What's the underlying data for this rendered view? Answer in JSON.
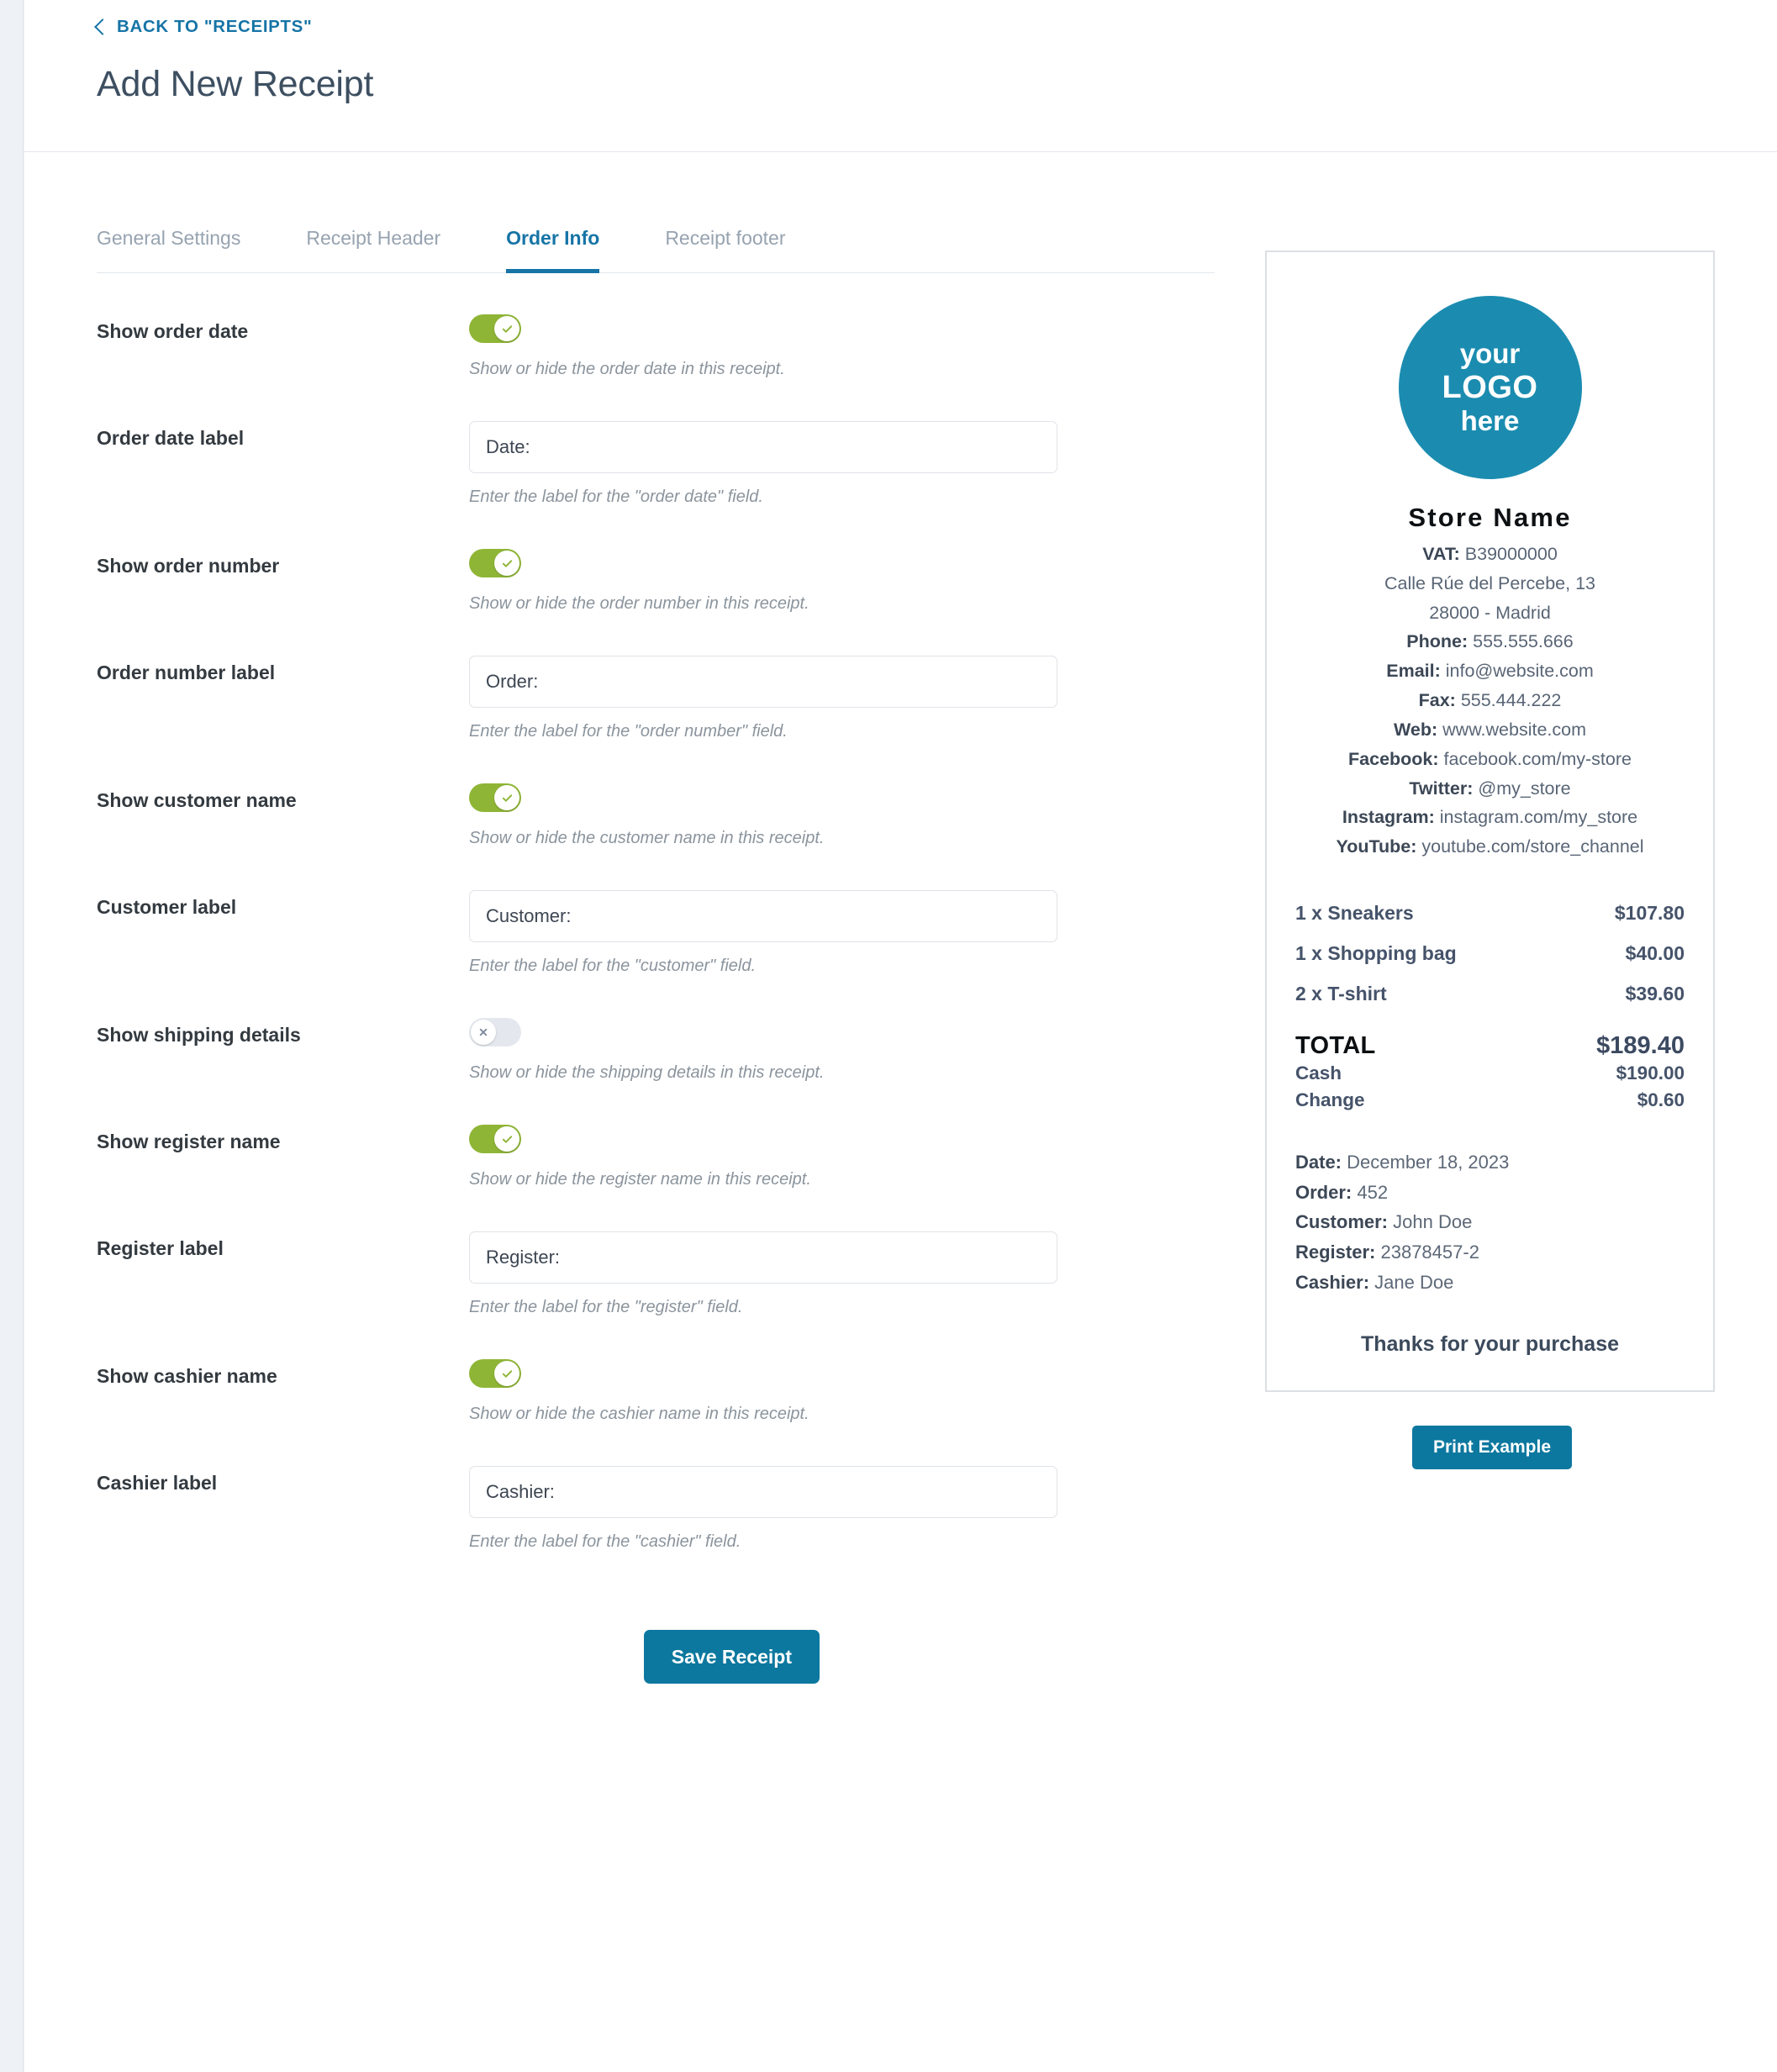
{
  "header": {
    "back_label": "BACK TO \"RECEIPTS\"",
    "title": "Add New Receipt"
  },
  "tabs": [
    {
      "label": "General Settings",
      "active": false
    },
    {
      "label": "Receipt Header",
      "active": false
    },
    {
      "label": "Order Info",
      "active": true
    },
    {
      "label": "Receipt footer",
      "active": false
    }
  ],
  "fields": {
    "show_order_date": {
      "label": "Show order date",
      "hint": "Show or hide the order date in this receipt.",
      "state": "on"
    },
    "order_date_label": {
      "label": "Order date label",
      "value": "Date:",
      "placeholder": "Date:",
      "hint": "Enter the label for the \"order date\" field."
    },
    "show_order_number": {
      "label": "Show order number",
      "hint": "Show or hide the order number in this receipt.",
      "state": "on"
    },
    "order_number_label": {
      "label": "Order number label",
      "value": "Order:",
      "placeholder": "Order:",
      "hint": "Enter the label for the \"order number\" field."
    },
    "show_customer_name": {
      "label": "Show customer name",
      "hint": "Show or hide the customer name in this receipt.",
      "state": "on"
    },
    "customer_label": {
      "label": "Customer label",
      "value": "Customer:",
      "placeholder": "Customer:",
      "hint": "Enter the label for the \"customer\" field."
    },
    "show_shipping_details": {
      "label": "Show shipping details",
      "hint": "Show or hide the shipping details in this receipt.",
      "state": "off"
    },
    "show_register_name": {
      "label": "Show register name",
      "hint": "Show or hide the register name in this receipt.",
      "state": "on"
    },
    "register_label": {
      "label": "Register label",
      "value": "Register:",
      "placeholder": "Register:",
      "hint": "Enter the label for the \"register\" field."
    },
    "show_cashier_name": {
      "label": "Show cashier name",
      "hint": "Show or hide the cashier name in this receipt.",
      "state": "on"
    },
    "cashier_label": {
      "label": "Cashier label",
      "value": "Cashier:",
      "placeholder": "Cashier:",
      "hint": "Enter the label for the \"cashier\" field."
    }
  },
  "actions": {
    "save_label": "Save Receipt",
    "print_label": "Print Example"
  },
  "receipt": {
    "logo": {
      "line1": "your",
      "line2": "LOGO",
      "line3": "here"
    },
    "store_name": "Store Name",
    "store_lines": [
      {
        "key": "VAT:",
        "value": "B39000000"
      },
      {
        "key": "",
        "value": "Calle Rúe del Percebe, 13"
      },
      {
        "key": "",
        "value": "28000 - Madrid"
      },
      {
        "key": "Phone:",
        "value": "555.555.666"
      },
      {
        "key": "Email:",
        "value": "info@website.com"
      },
      {
        "key": "Fax:",
        "value": "555.444.222"
      },
      {
        "key": "Web:",
        "value": "www.website.com"
      },
      {
        "key": "Facebook:",
        "value": "facebook.com/my-store"
      },
      {
        "key": "Twitter:",
        "value": "@my_store"
      },
      {
        "key": "Instagram:",
        "value": "instagram.com/my_store"
      },
      {
        "key": "YouTube:",
        "value": "youtube.com/store_channel"
      }
    ],
    "items": [
      {
        "name": "1 x Sneakers",
        "amount": "$107.80"
      },
      {
        "name": "1 x Shopping bag",
        "amount": "$40.00"
      },
      {
        "name": "2 x T-shirt",
        "amount": "$39.60"
      }
    ],
    "total": {
      "label": "TOTAL",
      "amount": "$189.40"
    },
    "payments": [
      {
        "label": "Cash",
        "amount": "$190.00"
      },
      {
        "label": "Change",
        "amount": "$0.60"
      }
    ],
    "meta": [
      {
        "key": "Date:",
        "value": "December 18, 2023"
      },
      {
        "key": "Order:",
        "value": "452"
      },
      {
        "key": "Customer:",
        "value": "John Doe"
      },
      {
        "key": "Register:",
        "value": "23878457-2"
      },
      {
        "key": "Cashier:",
        "value": "Jane Doe"
      }
    ],
    "thanks": "Thanks for your purchase"
  },
  "colors": {
    "accent_blue": "#1674a6",
    "button_blue": "#0d789f",
    "toggle_on_green": "#8fb536",
    "toggle_off_gray": "#e4e8ee",
    "logo_teal": "#1b8cb0",
    "title_slate": "#3d4f61"
  }
}
